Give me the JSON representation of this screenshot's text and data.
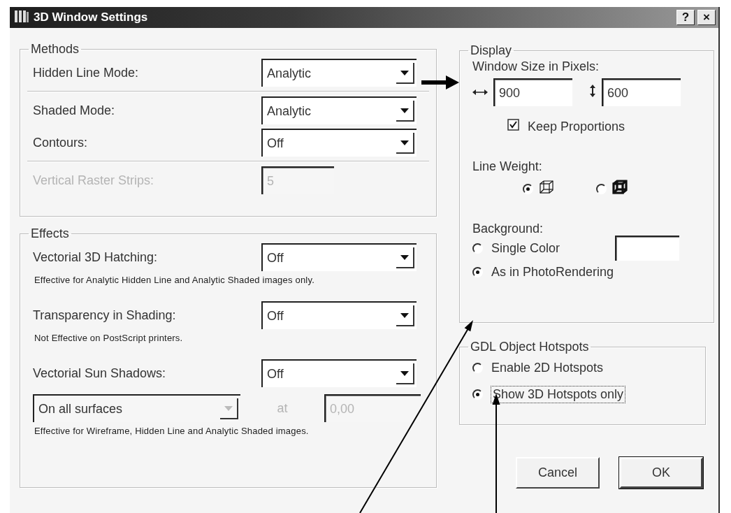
{
  "window": {
    "title": "3D Window Settings",
    "controls": [
      "?",
      "×"
    ]
  },
  "methods": {
    "title": "Methods",
    "sections": [
      {
        "rows": [
          {
            "kind": "dropdown",
            "label": "Hidden Line Mode:",
            "value": "Analytic",
            "disabled": false
          }
        ]
      },
      {
        "rows": [
          {
            "kind": "dropdown",
            "label": "Shaded Mode:",
            "value": "Analytic",
            "disabled": false
          },
          {
            "kind": "dropdown",
            "label": "Contours:",
            "value": "Off",
            "disabled": false
          }
        ]
      },
      {
        "rows": [
          {
            "kind": "field",
            "label": "Vertical Raster Strips:",
            "value": "5",
            "disabled": true
          }
        ]
      }
    ]
  },
  "effects": {
    "title": "Effects",
    "rows": [
      {
        "kind": "dropdown",
        "label": "Vectorial 3D Hatching:",
        "value": "Off",
        "note": "Effective for Analytic Hidden Line and Analytic Shaded images only."
      },
      {
        "kind": "dropdown",
        "label": "Transparency in Shading:",
        "value": "Off",
        "note": "Not Effective on PostScript printers."
      },
      {
        "kind": "dropdown",
        "label": "Vectorial Sun Shadows:",
        "value": "Off"
      },
      {
        "kind": "combo",
        "value": "On all surfaces",
        "at_label": "at",
        "at_value": "0,00",
        "note": "Effective for Wireframe, Hidden Line and Analytic Shaded images."
      }
    ]
  },
  "display": {
    "title": "Display",
    "size_label": "Window Size in Pixels:",
    "width_value": "900",
    "height_value": "600",
    "keep_proportions": {
      "label": "Keep Proportions",
      "checked": true
    },
    "line_weight": {
      "label": "Line Weight:",
      "options": [
        {
          "kind": "thin",
          "selected": true
        },
        {
          "kind": "thick",
          "selected": false
        }
      ]
    },
    "background": {
      "label": "Background:",
      "options": [
        {
          "kind": "color",
          "label": "Single Color",
          "selected": false
        },
        {
          "kind": "plain",
          "label": "As in PhotoRendering",
          "selected": true
        }
      ]
    }
  },
  "hotspots": {
    "title": "GDL Object Hotspots",
    "options": [
      {
        "label": "Enable 2D Hotspots",
        "selected": false,
        "focused": false
      },
      {
        "label": "Show 3D Hotspots only",
        "selected": true,
        "focused": true
      }
    ]
  },
  "buttons": [
    {
      "label": "Cancel",
      "default": false
    },
    {
      "label": "OK",
      "default": true
    }
  ]
}
